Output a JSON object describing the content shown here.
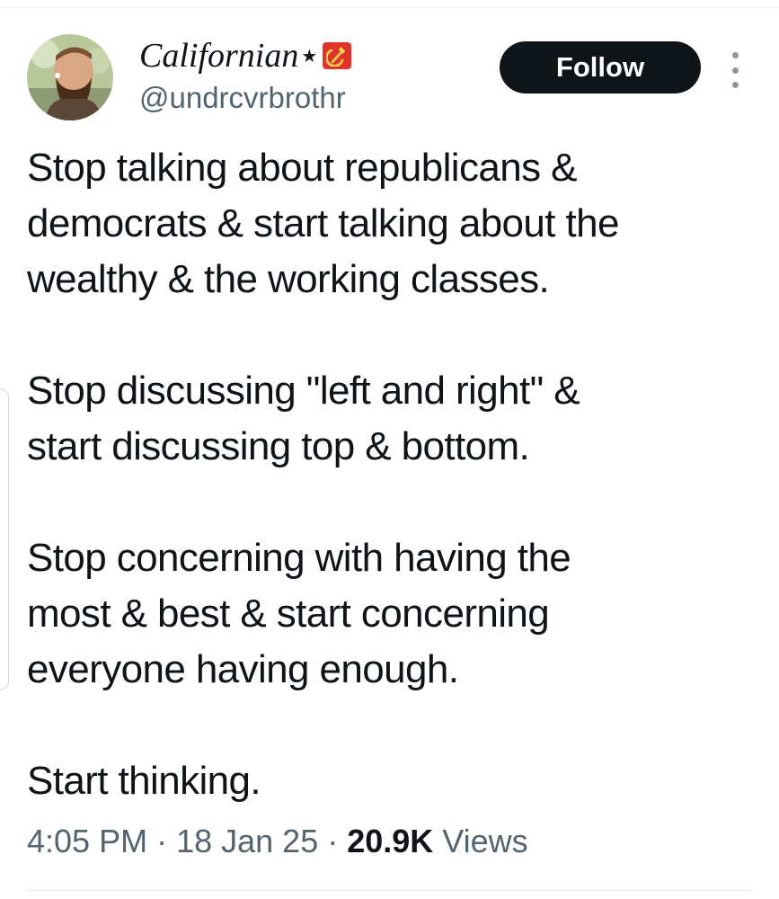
{
  "author": {
    "display_name": "Californian",
    "star_glyph": "★",
    "flag_icon": "hammer-and-sickle-icon",
    "handle": "@undrcvrbrothr"
  },
  "actions": {
    "follow_label": "Follow",
    "more_icon": "vertical-ellipsis-icon"
  },
  "tweet": {
    "paragraphs": [
      "Stop talking about republicans &\ndemocrats & start talking about the\nwealthy & the working classes.",
      "Stop discussing \"left and right\" &\nstart discussing top & bottom.",
      "Stop concerning with having the\nmost & best & start concerning\neveryone having enough.",
      "Start thinking."
    ]
  },
  "meta": {
    "time": "4:05 PM",
    "sep1": " · ",
    "date": "18 Jan 25",
    "sep2": " · ",
    "views_count": "20.9K",
    "views_label": " Views"
  },
  "colors": {
    "text_primary": "#0f1419",
    "text_secondary": "#536471",
    "follow_bg": "#0f1419",
    "flag_red": "#e0332b",
    "flag_gold": "#f7d64a"
  }
}
